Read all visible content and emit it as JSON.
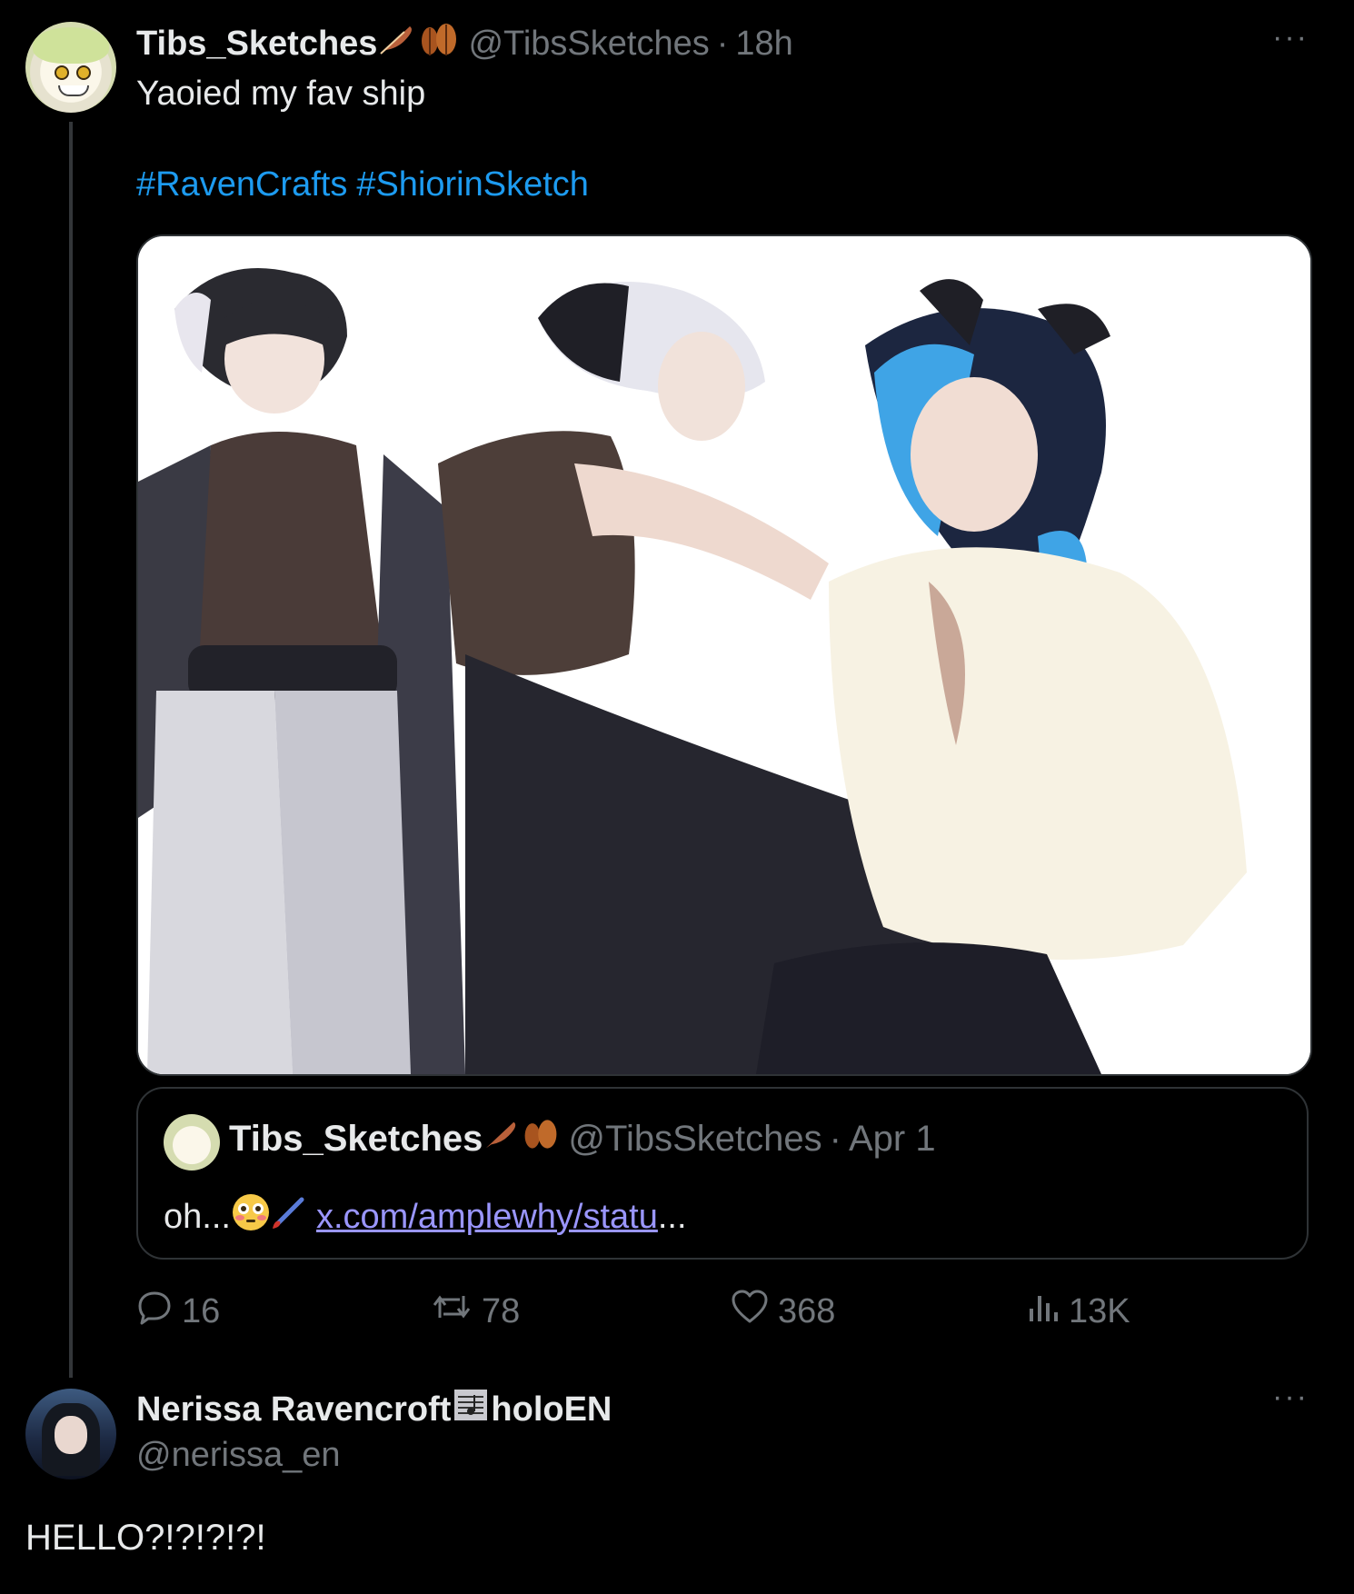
{
  "tweet": {
    "author_name": "Tibs_Sketches",
    "author_handle": "@TibsSketches",
    "separator": "·",
    "time": "18h",
    "text": "Yaoied my fav ship",
    "hashtags": [
      "#RavenCrafts",
      "#ShiorinSketch"
    ],
    "more_label": "···",
    "media_alt": "Drawing of three characters",
    "quote": {
      "author_name": "Tibs_Sketches",
      "author_handle": "@TibsSketches",
      "separator": "·",
      "date": "Apr 1",
      "text": "oh...",
      "link": "x.com/amplewhy/statu",
      "ellipsis": "..."
    },
    "stats": {
      "replies": "16",
      "reposts": "78",
      "likes": "368",
      "views": "13K"
    }
  },
  "reply": {
    "author_name_left": "Nerissa Ravencroft",
    "author_name_right": "holoEN",
    "author_handle": "@nerissa_en",
    "text": "HELLO?!?!?!?!",
    "more_label": "···"
  },
  "colors": {
    "background": "#000000",
    "text": "#e7e9ea",
    "muted": "#71767b",
    "link": "#1d9bf0",
    "quote_link": "#9a96ff",
    "border": "#2f3336"
  },
  "icons": [
    "feather-emoji",
    "leaves-emoji",
    "flushed-face-emoji",
    "paintbrush-emoji",
    "reply-icon",
    "repost-icon",
    "like-icon",
    "views-icon",
    "music-score-emoji",
    "more-icon"
  ]
}
